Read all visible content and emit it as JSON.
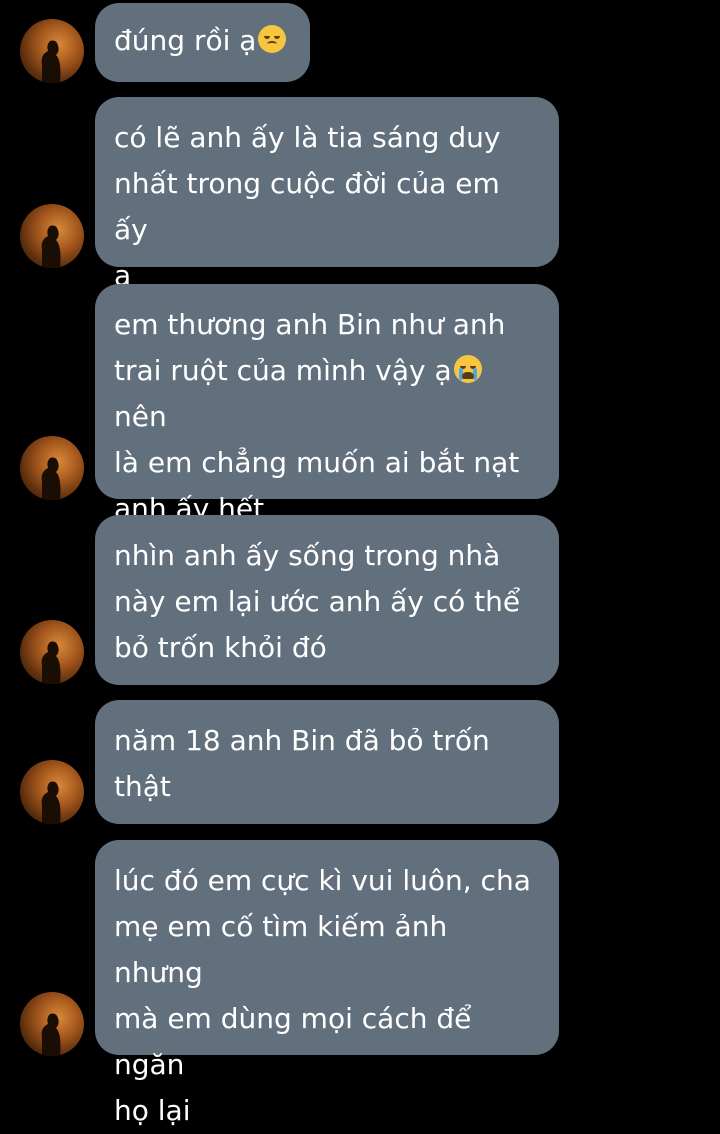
{
  "theme": {
    "background": "#000000",
    "bubble_color": "#62707e",
    "text_color": "#ffffff"
  },
  "messages": [
    {
      "pre": "đúng rồi ạ",
      "emoji": "disappointed-face",
      "post": ""
    },
    {
      "pre": "có lẽ anh ấy là tia sáng duy\nnhất trong cuộc đời của em ấy\nạ",
      "emoji": "",
      "post": ""
    },
    {
      "pre": "em thương anh Bin như anh\ntrai ruột của mình vậy ạ",
      "emoji": "loudly-crying-face",
      "post": " nên\nlà em chẳng muốn ai bắt nạt\nanh ấy hết"
    },
    {
      "pre": "nhìn anh ấy sống trong nhà\nnày em lại ước anh ấy có thể\nbỏ trốn khỏi đó",
      "emoji": "",
      "post": ""
    },
    {
      "pre": "năm 18 anh Bin đã bỏ trốn\nthật",
      "emoji": "",
      "post": ""
    },
    {
      "pre": "lúc đó em cực kì vui luôn, cha\nmẹ em cố tìm kiếm ảnh nhưng\nmà em dùng mọi cách để ngăn\nhọ lại",
      "emoji": "",
      "post": ""
    }
  ]
}
